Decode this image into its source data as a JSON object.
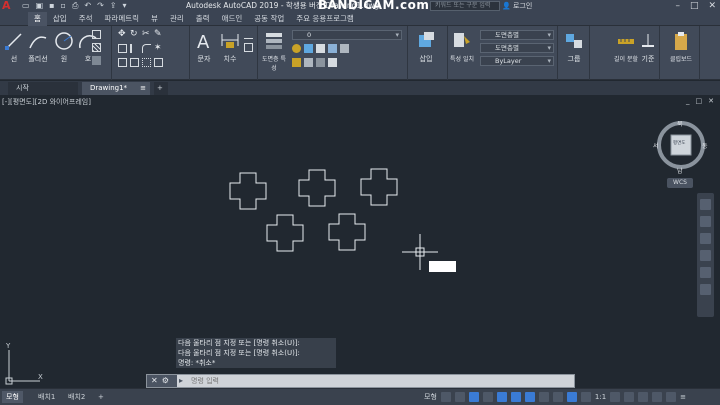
{
  "app": {
    "title": "Autodesk AutoCAD 2019  -  학생용 버전  Drawing1.dwg",
    "watermark": "BANDICAM.com",
    "search_placeholder": "키워드 또는 구문 입력",
    "user_label": "로그인",
    "logo_letter": "A"
  },
  "ribbon": {
    "tabs": [
      "홈",
      "삽입",
      "주석",
      "파라메트릭",
      "뷰",
      "관리",
      "출력",
      "애드인",
      "공동 작업",
      "주요 응용프로그램"
    ],
    "active_tab": "홈",
    "draw_buttons": [
      "선",
      "폴리선",
      "원",
      "호"
    ],
    "text_button": "문자",
    "dim_button": "치수",
    "table_button": "도면층 특성",
    "layer_dropdown_value": "0",
    "insert_button": "삽입",
    "properties_match": "특성 일치",
    "prop_color": "도면층별",
    "prop_linetype": "도면층별",
    "prop_lineweight": "ByLayer",
    "group_button": "그룹",
    "measure_button": "길이 분할",
    "base_button": "기준",
    "clipboard_button": "클립보드",
    "panel_labels": [
      "그리기",
      "수정",
      "주석",
      "도면층",
      "블록",
      "특성",
      "그룹",
      "유틸리티",
      "클립보드"
    ]
  },
  "doc_tabs": {
    "start": "시작",
    "drawing": "Drawing1*",
    "add": "+"
  },
  "viewport": {
    "label": "[-][평면도][2D 와이어프레임]",
    "controls": [
      "_",
      "□",
      "✕"
    ],
    "viewcube": {
      "top": "평면도",
      "north": "북",
      "south": "남",
      "east": "동",
      "west": "서"
    },
    "wcs_label": "WCS"
  },
  "command": {
    "history": [
      "다음 울타리 점 지정 또는 [명령 취소(U)]:",
      "다음 울타리 점 지정 또는 [명령 취소(U)]:",
      "명령: *취소*"
    ],
    "placeholder": "명령 입력",
    "close_glyph": "✕",
    "custom_glyph": "🔧"
  },
  "layout_tabs": [
    "모형",
    "배치1",
    "배치2",
    "+"
  ],
  "status": {
    "model": "모형",
    "scale": "1:1",
    "coords_hidden": ""
  },
  "colors": {
    "viewport_bg": "#212830",
    "ribbon_bg": "#414a59",
    "logo_red": "#d32f2f"
  }
}
